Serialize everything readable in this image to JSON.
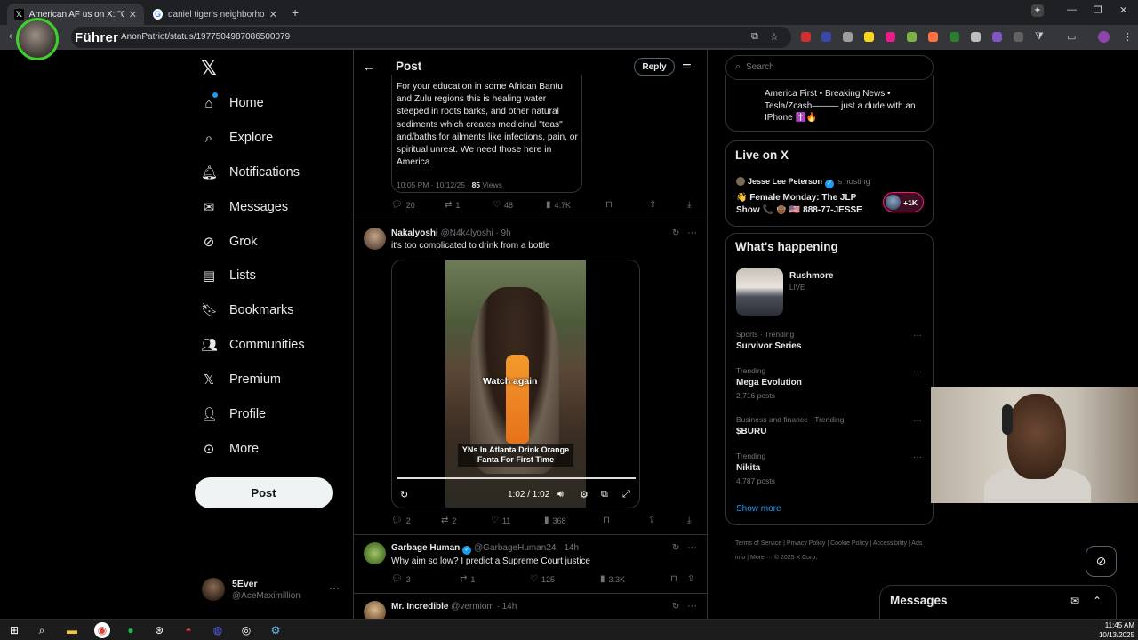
{
  "browser": {
    "tabs": [
      {
        "title": "American AF us on X: \"One of th",
        "active": true
      },
      {
        "title": "daniel tiger's neighborhood - G",
        "active": false
      }
    ],
    "url": "AnonPatriot/status/1977504987086500079",
    "overlay_label": "Führer"
  },
  "nav": {
    "items": [
      "Home",
      "Explore",
      "Notifications",
      "Messages",
      "Grok",
      "Lists",
      "Bookmarks",
      "Communities",
      "Premium",
      "Profile",
      "More"
    ],
    "post_button": "Post",
    "account": {
      "name": "5Ever",
      "handle": "@AceMaximillion"
    }
  },
  "header": {
    "title": "Post",
    "reply_button": "Reply"
  },
  "quoted_post": {
    "text": "For your education in some African Bantu and Zulu regions this is healing water steeped in roots barks, and other natural sediments which creates medicinal \"teas\" and/baths for ailments like infections, pain, or spiritual unrest. We need those here in America.",
    "timestamp": "10:05 PM · 10/12/25 · ",
    "views_count": "85",
    "views_label": " Views"
  },
  "main_actions": {
    "replies": "20",
    "reposts": "1",
    "likes": "48",
    "views": "4.7K"
  },
  "replies": [
    {
      "name": "Nakalyoshi",
      "handle": "@N4k4lyoshi · 9h",
      "text": "it's too complicated to drink from a bottle",
      "video": {
        "overlay": "Watch again",
        "caption": "YNs In Atlanta Drink Orange Fanta For First Time",
        "time": "1:02 / 1:02"
      },
      "actions": {
        "replies": "2",
        "reposts": "2",
        "likes": "11",
        "views": "368"
      }
    },
    {
      "name": "Garbage Human",
      "handle": "@GarbageHuman24 · 14h",
      "text": "Why aim so low? I predict a Supreme Court justice",
      "actions": {
        "replies": "3",
        "reposts": "1",
        "likes": "125",
        "views": "3.3K"
      }
    },
    {
      "name": "Mr. Incredible",
      "handle": "@vermiom · 14h"
    }
  ],
  "search": {
    "placeholder": "Search"
  },
  "profile_bio": "America First • Breaking News • Tesla/Zcash——— just a dude with an IPhone ✝️🔥",
  "live": {
    "title": "Live on X",
    "host": "Jesse Lee Peterson",
    "hosting_label": "is hosting",
    "show_title": "👋 Female Monday: The JLP Show 📞 👴🏾 🇺🇸 888-77-JESSE",
    "listeners": "+1K"
  },
  "happening": {
    "title": "What's happening",
    "featured": {
      "name": "Rushmore",
      "status": "LIVE"
    },
    "trends": [
      {
        "category": "Sports · Trending",
        "name": "Survivor Series",
        "posts": ""
      },
      {
        "category": "Trending",
        "name": "Mega Evolution",
        "posts": "2,716 posts"
      },
      {
        "category": "Business and finance · Trending",
        "name": "$BURU",
        "posts": ""
      },
      {
        "category": "Trending",
        "name": "Nikita",
        "posts": "4,787 posts"
      }
    ],
    "show_more": "Show more"
  },
  "footer": "Terms of Service  |  Privacy Policy  |  Cookie Policy  |  Accessibility  |  Ads info  |  More ···  © 2025 X Corp.",
  "messages_drawer": {
    "title": "Messages"
  },
  "taskbar": {
    "time": "11:45 AM",
    "date": "10/13/2025"
  },
  "colors": {
    "accent": "#1d9bf0",
    "live_pink": "#f91880",
    "background": "#000000"
  }
}
